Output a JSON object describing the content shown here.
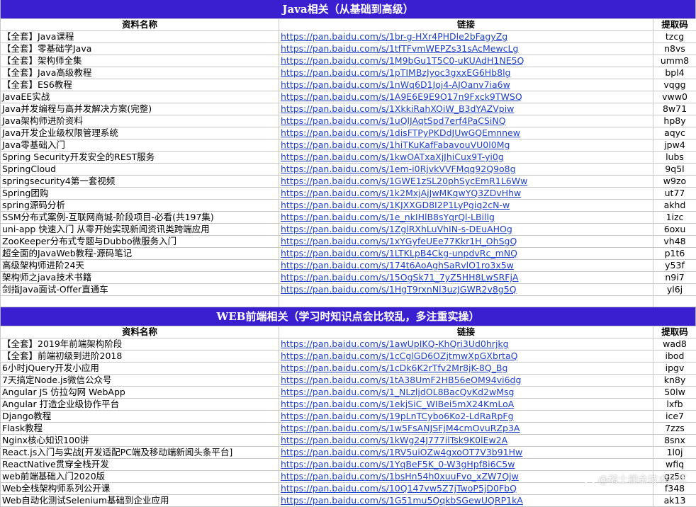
{
  "headers": {
    "name": "资料名称",
    "link": "链接",
    "code": "提取码"
  },
  "sections": [
    {
      "title": "Java相关（从基础到高级）",
      "rows": [
        {
          "name": "【全套】Java课程",
          "link": "https://pan.baidu.com/s/1br-g-HXr4PHDle2bFagyZg",
          "code": "tzcg"
        },
        {
          "name": "【全套】零基础学Java",
          "link": "https://pan.baidu.com/s/1tfTFvmWEPZs31sAcMewcLg",
          "code": "n8vs"
        },
        {
          "name": "【全套】架构师全集",
          "link": "https://pan.baidu.com/s/1M9bGu1T5C0-uKUAdH1NE5Q",
          "code": "umm8"
        },
        {
          "name": "【全套】Java高级教程",
          "link": "https://pan.baidu.com/s/1pTIMBzJyoc3gxxEG6Hb8lg",
          "code": "bpl4"
        },
        {
          "name": "【全套】ES6教程",
          "link": "https://pan.baidu.com/s/1nWq6D1Joj4-AJOanv7ia6w",
          "code": "vqgg"
        },
        {
          "name": "JavaEE实战",
          "link": "https://pan.baidu.com/s/1A9E6E9E9O17n9Fxck9TWSQ",
          "code": "vww0"
        },
        {
          "name": "Java并发编程与高并发解决方案(完整)",
          "link": "https://pan.baidu.com/s/1XkkiRahXOiW_B3dYAZVpiw",
          "code": "8w71"
        },
        {
          "name": "Java架构师进阶资料",
          "link": "https://pan.baidu.com/s/1uQlJAqtSpd7erf4PaCSiNQ",
          "code": "hp8y"
        },
        {
          "name": "Java开发企业级权限管理系统",
          "link": "https://pan.baidu.com/s/1disFTPyPKDdJUwGQEmnnew",
          "code": "aqyc"
        },
        {
          "name": "Java零基础入门",
          "link": "https://pan.baidu.com/s/1hiTKuKafFabavouVU0l0Mg",
          "code": "jpw4"
        },
        {
          "name": "Spring Security开发安全的REST服务",
          "link": "https://pan.baidu.com/s/1kwOATxaXjJhiCux9T-yi0g",
          "code": "lubs"
        },
        {
          "name": "SpringCloud",
          "link": "https://pan.baidu.com/s/1em-i0RjvkVVFMqq92Q9o8g",
          "code": "9q5l"
        },
        {
          "name": "springsecurity4第一套视频",
          "link": "https://pan.baidu.com/s/1GWE1zSL20phSycEmR1L6Ww",
          "code": "w9zo"
        },
        {
          "name": "Spring团购",
          "link": "https://pan.baidu.com/s/1k2MxjAjJwMKqwYQ3ZDvHhw",
          "code": "ut77"
        },
        {
          "name": "spring源码分析",
          "link": "https://pan.baidu.com/s/1KJXXGD8I2P1LyPgiq2cN-w",
          "code": "akhd"
        },
        {
          "name": "SSM分布式案例-互联网商城-阶段项目-必看(共197集)",
          "link": "https://pan.baidu.com/s/1e_nkIHlB8sYqrQl-LBillg",
          "code": "1izc"
        },
        {
          "name": "uni-app 快速入门 从零开始实现新闻资讯类跨端应用",
          "link": "https://pan.baidu.com/s/1ZglRXhLuVhIN-s-DEuAHOg",
          "code": "6oxu"
        },
        {
          "name": "ZooKeeper分布式专题与Dubbo微服务入门",
          "link": "https://pan.baidu.com/s/1xYGyfeUEe77Kkr1H_OhSgQ",
          "code": "vh48"
        },
        {
          "name": "超全面的JavaWeb教程-源码笔记",
          "link": "https://pan.baidu.com/s/1LTKLpB4Ckg-unpdvRc_mNQ",
          "code": "p1t6"
        },
        {
          "name": "高级架构师进阶24天",
          "link": "https://pan.baidu.com/s/174t6AoAghSaRvlO1ro3x5w",
          "code": "y53f"
        },
        {
          "name": "架构师之java技术书籍",
          "link": "https://pan.baidu.com/s/15OgSk71_7yZ5HH8LwSRFjA",
          "code": "n9i7"
        },
        {
          "name": "剑指Java面试-Offer直通车",
          "link": "https://pan.baidu.com/s/1HgT9rxnNl3uzJGWR2v8g5Q",
          "code": "yl6j"
        }
      ]
    },
    {
      "title": "WEB前端相关（学习时知识点会比较乱，多注重实操）",
      "rows": [
        {
          "name": "【全套】2019年前端架构阶段",
          "link": "https://pan.baidu.com/s/1awUpIKQ-KhQri3Ud0hrjkg",
          "code": "wad8"
        },
        {
          "name": "【全套】前端初级到进阶2018",
          "link": "https://pan.baidu.com/s/1cCglGD6OZjtmwXpGXbrtaQ",
          "code": "ibod"
        },
        {
          "name": "6小时jQuery开发小应用",
          "link": "https://pan.baidu.com/s/1cDk6K2rTfv2Mr8jK-8Q_Bg",
          "code": "ipgv"
        },
        {
          "name": "7天搞定Node.js微信公众号",
          "link": "https://pan.baidu.com/s/1tA38UmF2HB56eOM94vi6dg",
          "code": "kn8y"
        },
        {
          "name": "Angular JS 仿拉勾网 WebApp",
          "link": "https://pan.baidu.com/s/1_NLzljdOL8BacQvKd2wMsg",
          "code": "50lw"
        },
        {
          "name": "Angular 打造企业级协作平台",
          "link": "https://pan.baidu.com/s/1ekjSiC_WIBei5mX24KmLoA",
          "code": "lxfb"
        },
        {
          "name": "Django教程",
          "link": "https://pan.baidu.com/s/19pLnTCybo6Ko2-LdRaRpFg",
          "code": "ice7"
        },
        {
          "name": "Flask教程",
          "link": "https://pan.baidu.com/s/1w5FsANJSFjM4cmOvuRZp3A",
          "code": "7zzs"
        },
        {
          "name": "Nginx核心知识100讲",
          "link": "https://pan.baidu.com/s/1kWg24J777ilTsk9K0lEw2A",
          "code": "8snx"
        },
        {
          "name": "React.js入门与实战[开发适配PC端及移动端新闻头条平台]",
          "link": "https://pan.baidu.com/s/1RV5uiOZw4gxoOT7V3b91Hw",
          "code": "1l0j"
        },
        {
          "name": "ReactNative贯穿全栈开发",
          "link": "https://pan.baidu.com/s/1YqBeF5K_0-W3gHpf8i6C5w",
          "code": "wfiq"
        },
        {
          "name": "web前端基础入门2020版",
          "link": "https://pan.baidu.com/s/1bsHn54h0xuuFvo_xZW7Qjw",
          "code": "gz5o"
        },
        {
          "name": "Web全栈架构师系列公开课",
          "link": "https://pan.baidu.com/s/10Q147vw5Z7jTwoP5jD0FbQ",
          "code": "f348"
        },
        {
          "name": "Web自动化测试Selenium基础到企业应用",
          "link": "https://pan.baidu.com/s/1G51mu5QqkbSGewUQRP1kA",
          "code": "ak13"
        }
      ]
    }
  ],
  "watermark": {
    "text": "@稀土掘金技术社区",
    "icon": "juejin-logo-icon"
  }
}
